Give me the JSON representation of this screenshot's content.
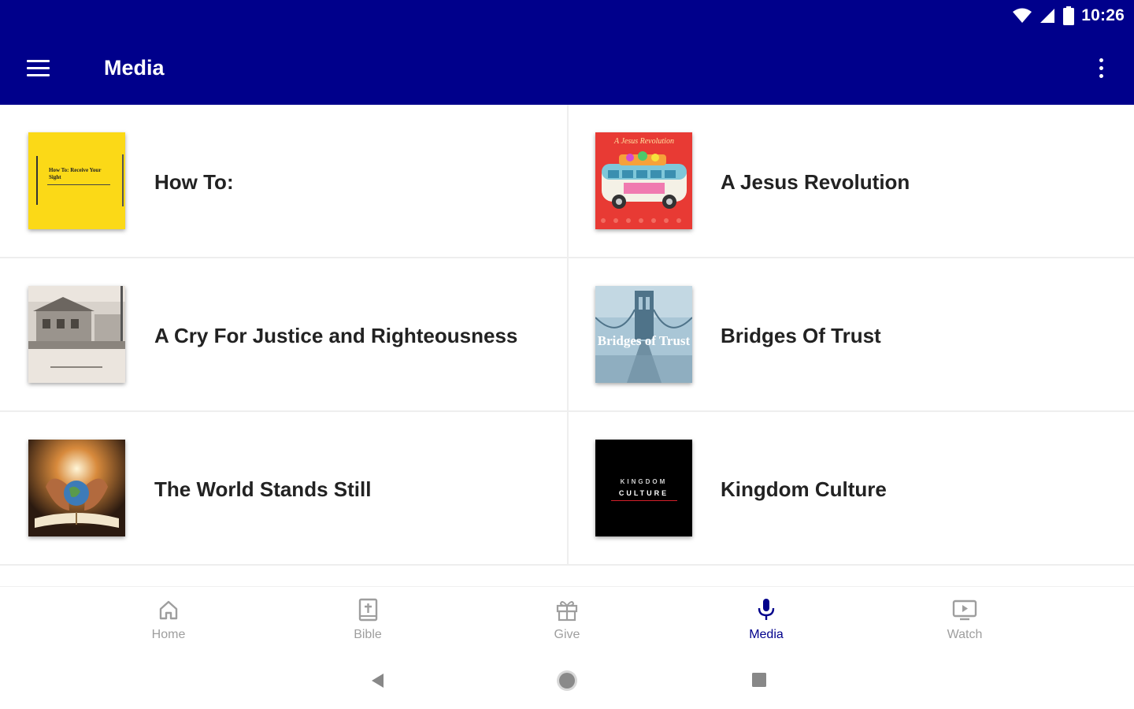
{
  "status_bar": {
    "time": "10:26",
    "icons": [
      "wifi-icon",
      "signal-icon",
      "battery-icon"
    ]
  },
  "app_bar": {
    "title": "Media",
    "menu_icon": "hamburger-menu-icon",
    "overflow_icon": "more-vert-icon",
    "background": "#00008b"
  },
  "media_items": [
    {
      "title": "How To:",
      "thumb_text": "How To: Receive Your Sight"
    },
    {
      "title": "A Jesus Revolution",
      "thumb_text": "A Jesus Revolution"
    },
    {
      "title": "A Cry For Justice and Righteousness"
    },
    {
      "title": "Bridges Of Trust",
      "thumb_text": "Bridges of Trust"
    },
    {
      "title": "The World Stands Still"
    },
    {
      "title": "Kingdom Culture",
      "thumb_text_1": "KINGDOM",
      "thumb_text_2": "CULTURE"
    }
  ],
  "bottom_nav": {
    "active_color": "#00008b",
    "inactive_color": "#9e9e9e",
    "items": [
      {
        "label": "Home",
        "icon": "home-icon"
      },
      {
        "label": "Bible",
        "icon": "bible-icon"
      },
      {
        "label": "Give",
        "icon": "gift-icon"
      },
      {
        "label": "Media",
        "icon": "microphone-icon",
        "active": true
      },
      {
        "label": "Watch",
        "icon": "watch-tv-icon"
      }
    ]
  },
  "system_nav": [
    "back-icon",
    "home-circle-icon",
    "recents-icon"
  ]
}
